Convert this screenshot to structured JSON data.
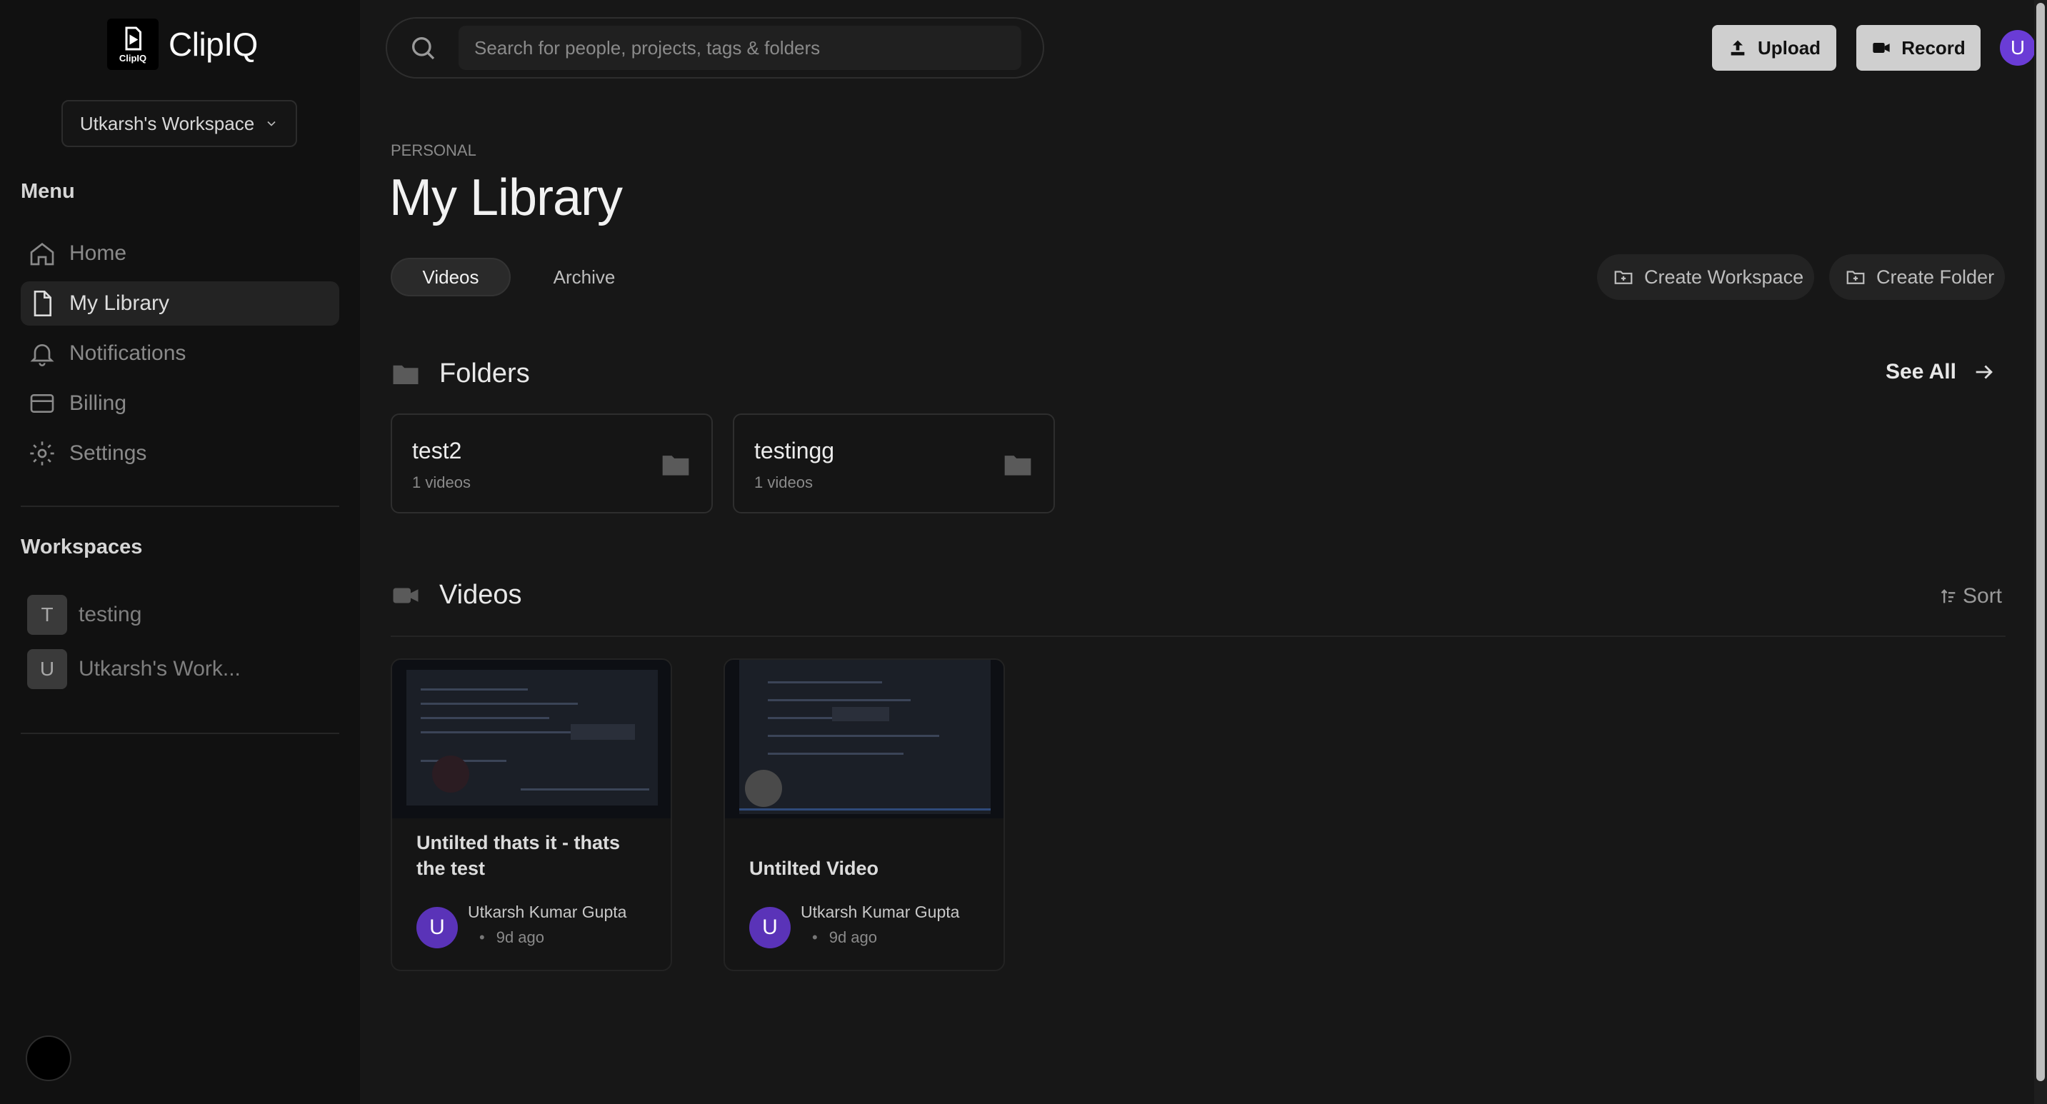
{
  "brand": {
    "name": "ClipIQ",
    "logo_text": "ClipIQ"
  },
  "workspace_selector": {
    "value": "Utkarsh's Workspace"
  },
  "sidebar": {
    "menu_label": "Menu",
    "items": [
      {
        "label": "Home",
        "icon": "home-icon",
        "active": false
      },
      {
        "label": "My Library",
        "icon": "file-icon",
        "active": true
      },
      {
        "label": "Notifications",
        "icon": "bell-icon",
        "active": false
      },
      {
        "label": "Billing",
        "icon": "credit-card-icon",
        "active": false
      },
      {
        "label": "Settings",
        "icon": "gear-icon",
        "active": false
      }
    ],
    "workspaces_label": "Workspaces",
    "workspaces": [
      {
        "initial": "T",
        "name": "testing"
      },
      {
        "initial": "U",
        "name": "Utkarsh's Work..."
      }
    ]
  },
  "search": {
    "placeholder": "Search for people, projects, tags & folders"
  },
  "toolbar": {
    "upload_label": "Upload",
    "record_label": "Record",
    "user_initial": "U"
  },
  "page": {
    "eyebrow": "PERSONAL",
    "title": "My Library",
    "tabs": [
      {
        "label": "Videos",
        "active": true
      },
      {
        "label": "Archive",
        "active": false
      }
    ],
    "create_workspace_label": "Create Workspace",
    "create_folder_label": "Create Folder"
  },
  "folders": {
    "heading": "Folders",
    "see_all_label": "See All",
    "items": [
      {
        "name": "test2",
        "count": "1 videos"
      },
      {
        "name": "testingg",
        "count": "1 videos"
      }
    ]
  },
  "videos": {
    "heading": "Videos",
    "sort_label": "Sort",
    "items": [
      {
        "title": "Untilted thats it - thats the test",
        "author": "Utkarsh Kumar Gupta",
        "author_initial": "U",
        "time": "9d ago"
      },
      {
        "title": "Untilted Video",
        "author": "Utkarsh Kumar Gupta",
        "author_initial": "U",
        "time": "9d ago"
      }
    ]
  },
  "colors": {
    "accent": "#5a33b8",
    "background": "#171717",
    "sidebar": "#111111"
  }
}
